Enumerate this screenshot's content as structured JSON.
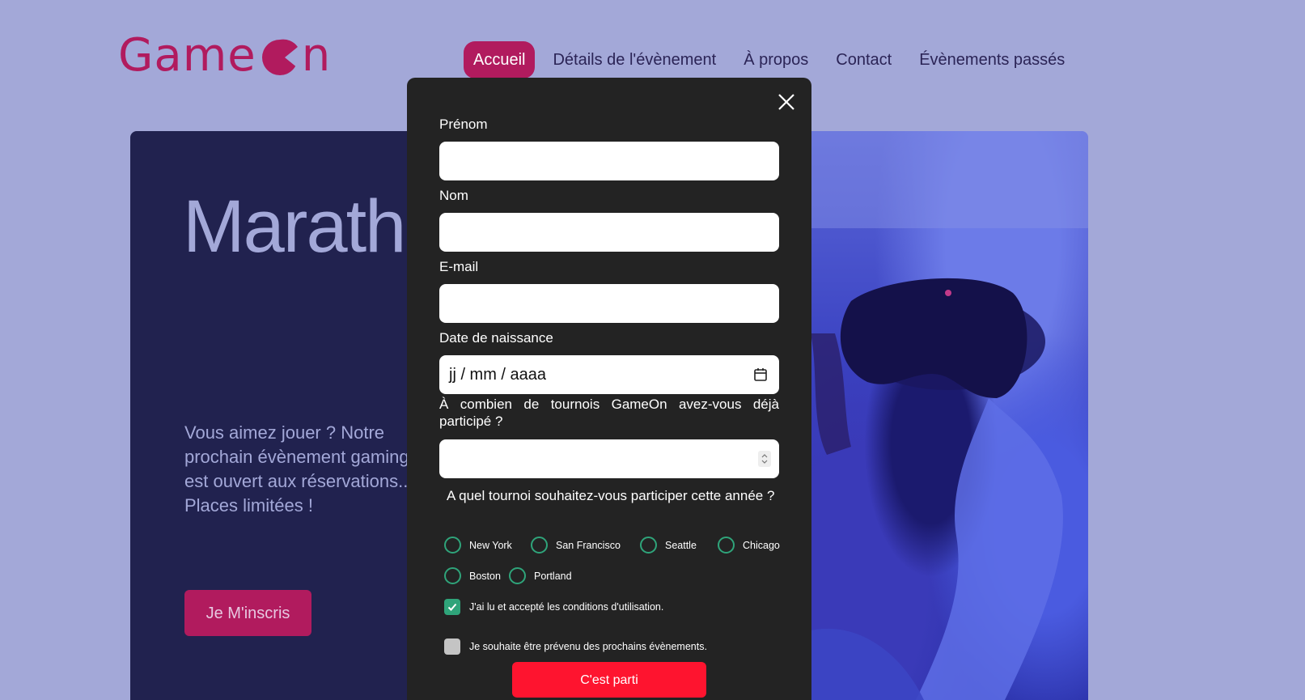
{
  "brand": {
    "logo_text_start": "Game",
    "logo_text_end": "n",
    "accent": "#b11b5e"
  },
  "nav": {
    "items": [
      {
        "label": "Accueil",
        "active": true
      },
      {
        "label": "Détails de l'évènement"
      },
      {
        "label": "À propos"
      },
      {
        "label": "Contact"
      },
      {
        "label": "Évènements passés"
      }
    ]
  },
  "hero": {
    "title": "Marathon national de jeux vidéos",
    "text": "Vous aimez jouer ? Notre prochain évènement gaming est ouvert aux réservations... Places limitées !",
    "cta_label": "Je M'inscris"
  },
  "form": {
    "first_name_label": "Prénom",
    "last_name_label": "Nom",
    "email_label": "E-mail",
    "birthdate_label": "Date de naissance",
    "birthdate_placeholder": "jj / mm / aaaa",
    "quantity_question": "À combien de tournois GameOn avez-vous déjà participé ?",
    "location_question": "A quel tournoi souhaitez-vous participer cette année ?",
    "locations": [
      "New York",
      "San Francisco",
      "Seattle",
      "Chicago",
      "Boston",
      "Portland"
    ],
    "terms_label": "J'ai lu et accepté les conditions d'utilisation.",
    "terms_checked": true,
    "newsletter_label": "Je souhaite être prévenu des prochains évènements.",
    "newsletter_checked": false,
    "submit_label": "C'est parti",
    "submit_color": "#fe142f",
    "radio_color": "#2fa47a"
  }
}
